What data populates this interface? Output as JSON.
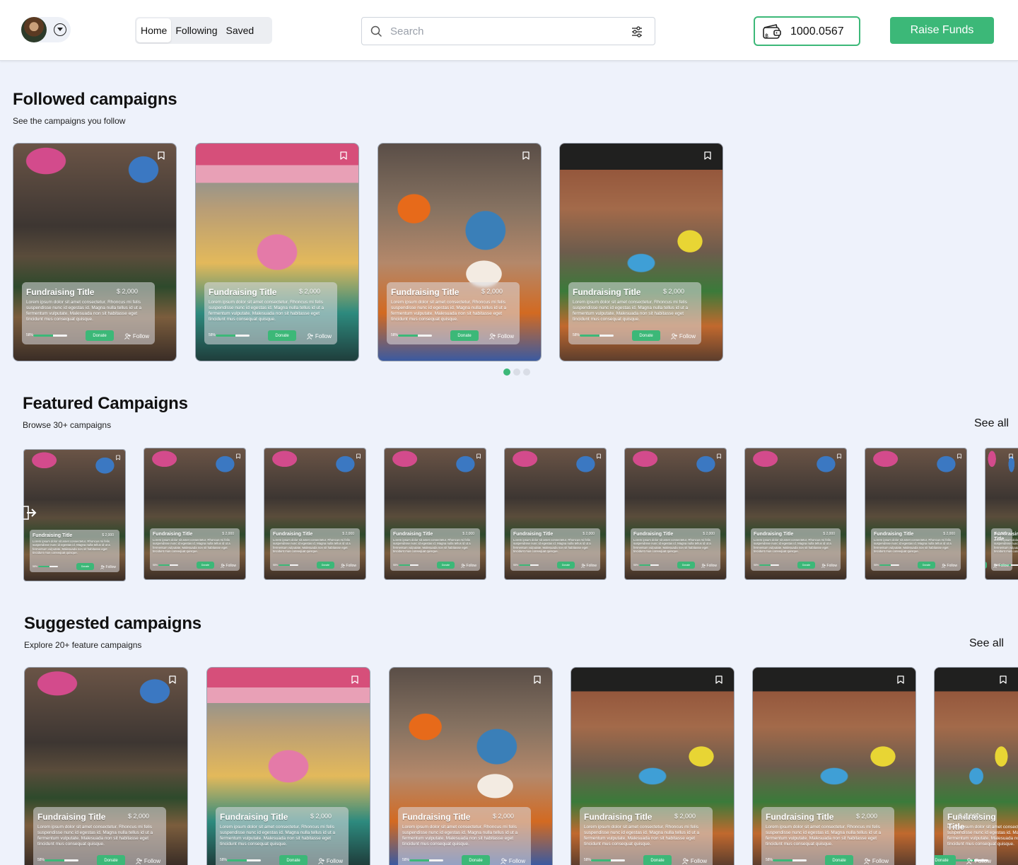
{
  "header": {
    "nav": [
      "Home",
      "Following",
      "Saved"
    ],
    "active_tab": "Home",
    "search_placeholder": "Search",
    "wallet_balance": "1000.0567",
    "raise_button": "Raise Funds"
  },
  "sections": {
    "followed": {
      "title": "Followed campaigns",
      "subtitle": "See the campaigns you follow"
    },
    "featured": {
      "title": "Featured Campaigns",
      "subtitle": "Browse 30+ campaigns",
      "see_all": "See all"
    },
    "suggested": {
      "title": "Suggested campaigns",
      "subtitle": "Explore 20+ feature campaigns",
      "see_all": "See all"
    }
  },
  "card": {
    "title": "Fundraising Title",
    "amount": "$ 2,000",
    "description": "Lorem ipsum dolor sit amet consectetur. Rhoncus mi felis suspendisse nunc id egestas id. Magna nulla tellus id ut a fermentum vulputate. Malesuada non sit habitasse eget tincidunt mus consequat quisque.",
    "progress_label": "58%",
    "progress": 0.58,
    "donate": "Donate",
    "follow": "Follow"
  },
  "carousel": {
    "pages": 3,
    "active": 0
  },
  "icons": [
    "avatar",
    "chevron-down-icon",
    "search-icon",
    "filter-icon",
    "wallet-icon",
    "bookmark-icon",
    "follow-icon",
    "arrow-right-icon"
  ],
  "colors": {
    "accent": "#3cb878",
    "background": "#eef2fb"
  }
}
